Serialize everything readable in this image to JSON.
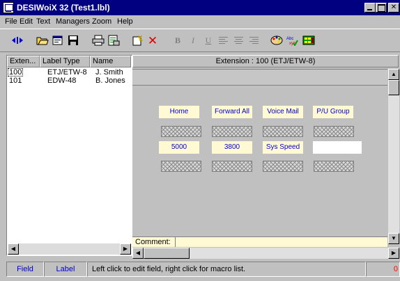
{
  "window": {
    "title": "DESIWoiX 32 (Test1.lbl)"
  },
  "menu": [
    "File",
    "Edit",
    "Text",
    "Managers",
    "Zoom",
    "Help"
  ],
  "toolbar": {
    "icons": [
      "split-arrows-icon",
      "open-folder-icon",
      "properties-icon",
      "save-icon",
      "print-icon",
      "print-preview-icon",
      "new-label-icon",
      "delete-icon",
      "bold-icon",
      "italic-icon",
      "underline-icon",
      "align-left-icon",
      "align-center-icon",
      "align-right-icon",
      "palette-icon",
      "spell-check-icon",
      "keypad-icon"
    ],
    "bold": "B",
    "italic": "I",
    "underline": "U",
    "spell_text": "Abc xyz"
  },
  "list": {
    "columns": [
      "Exten...",
      "Label Type",
      "Name"
    ],
    "rows": [
      {
        "ext": "100",
        "type": "ETJ/ETW-8",
        "name": "J. Smith"
      },
      {
        "ext": "101",
        "type": "EDW-48",
        "name": "B. Jones"
      }
    ]
  },
  "extension_header": "Extension : 100  (ETJ/ETW-8)",
  "buttons": {
    "row1": [
      "Home",
      "Forward All",
      "Voice Mail",
      "P/U Group"
    ],
    "row2": [
      "5000",
      "3800",
      "Sys Speed",
      ""
    ]
  },
  "comment": {
    "label": "Comment:",
    "value": ""
  },
  "status": {
    "field": "Field",
    "label": "Label",
    "message": "Left click to edit field, right click for macro list.",
    "count": "0"
  },
  "colors": {
    "titlebar": "#000080",
    "field_yellow": "#fffad4",
    "field_text": "#0000cc",
    "status_count": "#ff0000"
  }
}
